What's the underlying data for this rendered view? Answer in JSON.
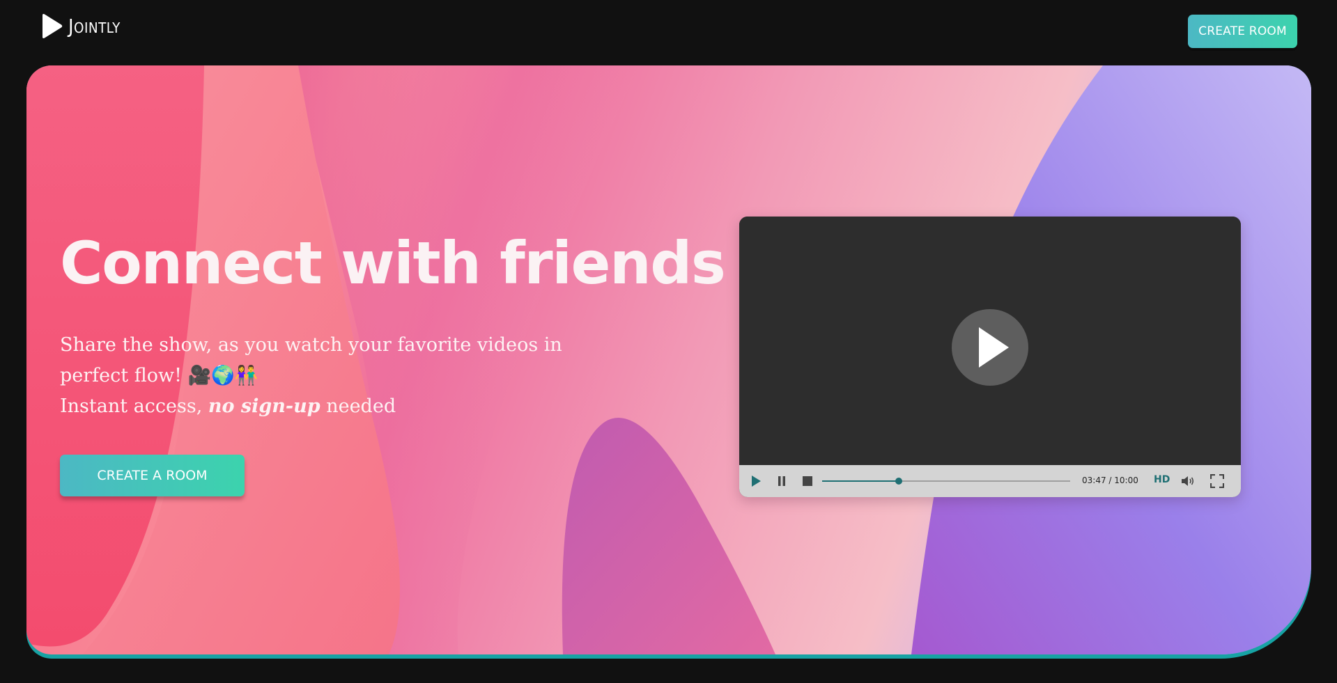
{
  "header": {
    "brand_name": "Jointly",
    "create_room_label": "CREATE ROOM"
  },
  "hero": {
    "headline": "Connect with friends",
    "subtext_line1": "Share the show, as you watch your favorite videos in perfect flow! 🎥🌍👫",
    "subtext_line2_before": "Instant access, ",
    "subtext_line2_emphasis": "no sign-up",
    "subtext_line2_after": " needed",
    "cta_label": "CREATE A ROOM"
  },
  "player": {
    "current_time": "03:47",
    "total_time": "10:00",
    "time_display": "03:47 / 10:00",
    "progress_fraction": 0.31,
    "quality_label": "HD",
    "icons": [
      "play-icon",
      "pause-icon",
      "stop-icon",
      "volume-icon",
      "fullscreen-icon"
    ]
  },
  "colors": {
    "page_bg": "#111111",
    "button_gradient_start": "#4cb8c4",
    "button_gradient_end": "#3cd3ad",
    "accent_teal": "#1f6f73"
  }
}
